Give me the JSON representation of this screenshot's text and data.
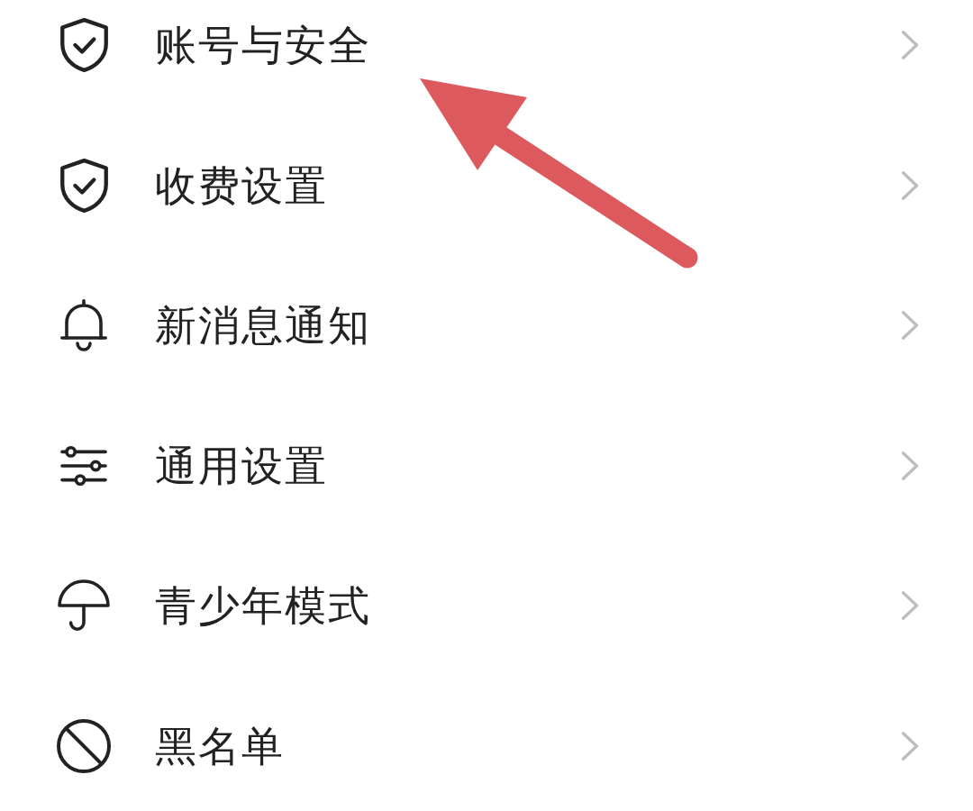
{
  "settings_items": [
    {
      "label": "账号与安全"
    },
    {
      "label": "收费设置"
    },
    {
      "label": "新消息通知"
    },
    {
      "label": "通用设置"
    },
    {
      "label": "青少年模式"
    },
    {
      "label": "黑名单"
    }
  ]
}
